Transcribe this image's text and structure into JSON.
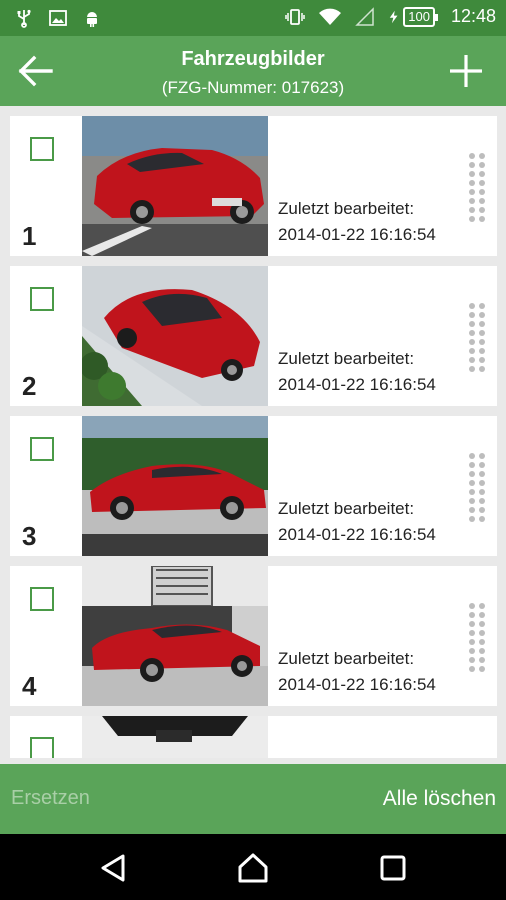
{
  "status_bar": {
    "time": "12:48",
    "battery": "100",
    "icons_left": [
      "usb-icon",
      "image-icon",
      "android-icon"
    ],
    "icons_right": [
      "vibrate-icon",
      "wifi-icon",
      "signal-icon",
      "charging-icon",
      "battery-icon"
    ]
  },
  "appbar": {
    "title": "Fahrzeugbilder",
    "subtitle": "(FZG-Nummer: 017623)"
  },
  "list": {
    "items": [
      {
        "number": "1",
        "edited_label": "Zuletzt bearbeitet:",
        "edited_at": "2014-01-22 16:16:54",
        "checked": false
      },
      {
        "number": "2",
        "edited_label": "Zuletzt bearbeitet:",
        "edited_at": "2014-01-22 16:16:54",
        "checked": false
      },
      {
        "number": "3",
        "edited_label": "Zuletzt bearbeitet:",
        "edited_at": "2014-01-22 16:16:54",
        "checked": false
      },
      {
        "number": "4",
        "edited_label": "Zuletzt bearbeitet:",
        "edited_at": "2014-01-22 16:16:54",
        "checked": false
      },
      {
        "number": "",
        "edited_label": "",
        "edited_at": "",
        "checked": false
      }
    ]
  },
  "actions": {
    "replace_label": "Ersetzen",
    "delete_all_label": "Alle löschen"
  },
  "colors": {
    "statusbar": "#3f8a3c",
    "appbar": "#5aa459",
    "checkbox": "#4a9a47",
    "car": "#c0141c"
  }
}
